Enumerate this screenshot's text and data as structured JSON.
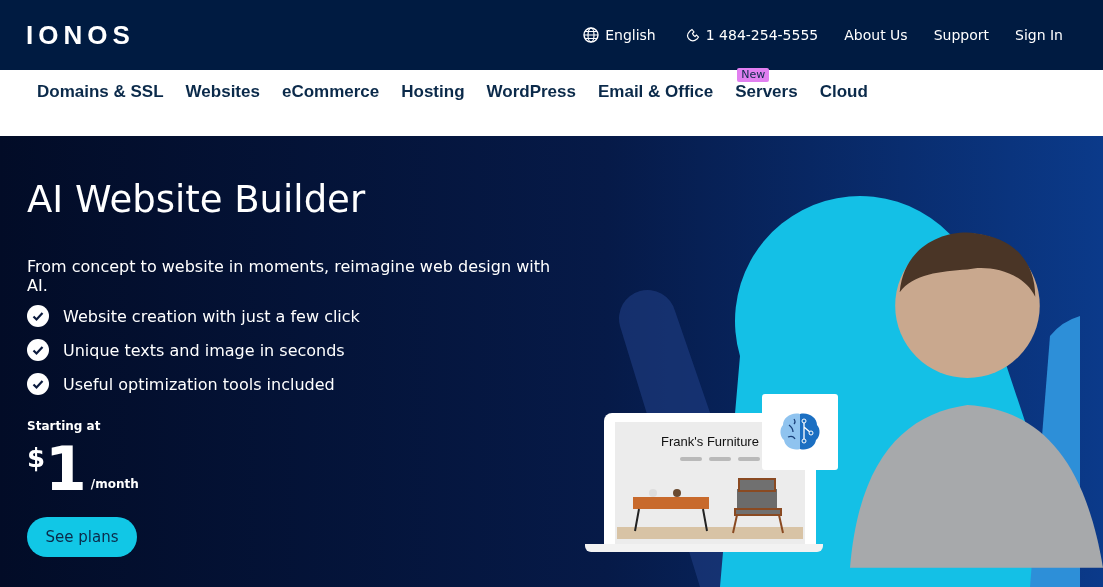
{
  "header": {
    "logo": "IONOS",
    "language": "English",
    "phone": "1 484-254-5555",
    "links": [
      "About Us",
      "Support",
      "Sign In"
    ]
  },
  "nav": [
    {
      "label": "Domains & SSL"
    },
    {
      "label": "Websites"
    },
    {
      "label": "eCommerce"
    },
    {
      "label": "Hosting"
    },
    {
      "label": "WordPress"
    },
    {
      "label": "Email & Office"
    },
    {
      "label": "Servers",
      "badge": "New"
    },
    {
      "label": "Cloud"
    }
  ],
  "hero": {
    "title": "AI Website Builder",
    "subtitle": "From concept to website in moments, reimagine web design with AI.",
    "features": [
      "Website creation with just a few click",
      "Unique texts and image in seconds",
      "Useful optimization tools included"
    ],
    "price_caption": "Starting at",
    "currency": "$",
    "amount": "1",
    "period": "/month",
    "button": "See plans",
    "mockup": {
      "site_title": "Frank's Furniture"
    }
  }
}
